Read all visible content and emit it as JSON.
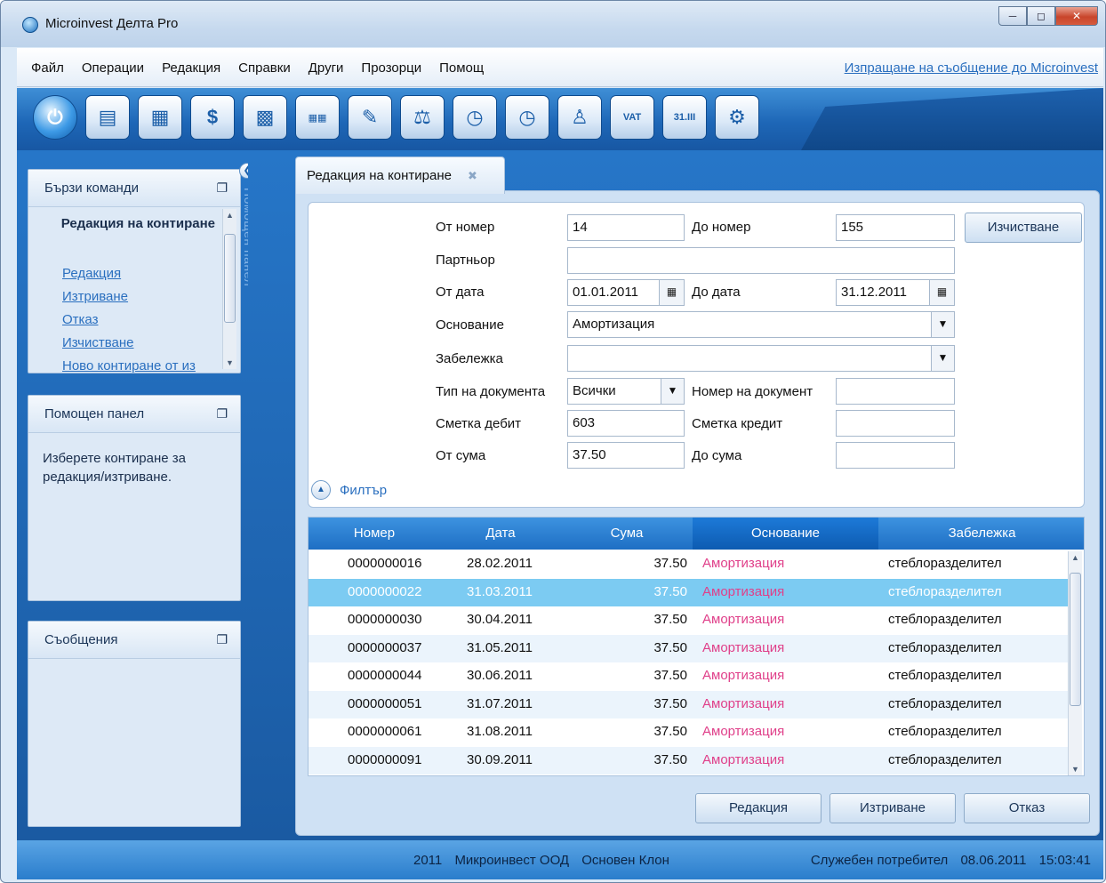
{
  "window": {
    "title": "Microinvest Делта Pro"
  },
  "menu": {
    "items": [
      "Файл",
      "Операции",
      "Редакция",
      "Справки",
      "Други",
      "Прозорци",
      "Помощ"
    ],
    "message_link": "Изпращане на съобщение до Microinvest"
  },
  "toolbar": {
    "buttons": [
      "power-icon",
      "documents-icon",
      "journal-icon",
      "cash-icon",
      "reports-icon",
      "accounts-table-icon",
      "edit-entry-icon",
      "balance-icon",
      "globe-clock-icon",
      "clock-icon",
      "person-icon",
      "vat-icon",
      "calendar-icon",
      "settings-gear-icon"
    ],
    "vat_text": "VAT",
    "cal_text": "31.III"
  },
  "left": {
    "quick_commands": {
      "title": "Бързи команди",
      "heading": "Редакция на контиране",
      "links": [
        "Редакция",
        "Изтриване",
        "Отказ",
        "Изчистване",
        "Ново контиране от из"
      ]
    },
    "help_panel": {
      "title": "Помощен панел",
      "text": "Изберете контиране за редакция/изтриване."
    },
    "messages": {
      "title": "Съобщения"
    },
    "side_label": "Помощен панел"
  },
  "tab": {
    "label": "Редакция на контиране"
  },
  "filter": {
    "from_number_label": "От номер",
    "from_number": "14",
    "to_number_label": "До номер",
    "to_number": "155",
    "clear_button": "Изчистване",
    "partner_label": "Партньор",
    "partner": "",
    "from_date_label": "От дата",
    "from_date": "01.01.2011",
    "to_date_label": "До дата",
    "to_date": "31.12.2011",
    "reason_label": "Основание",
    "reason": "Амортизация",
    "note_label": "Забележка",
    "note": "",
    "doc_type_label": "Тип на документа",
    "doc_type": "Всички",
    "doc_number_label": "Номер на документ",
    "doc_number": "",
    "debit_label": "Сметка дебит",
    "debit": "603",
    "credit_label": "Сметка кредит",
    "credit": "",
    "from_sum_label": "От сума",
    "from_sum": "37.50",
    "to_sum_label": "До сума",
    "to_sum": "",
    "toggle_label": "Филтър"
  },
  "grid": {
    "columns": [
      "Номер",
      "Дата",
      "Сума",
      "Основание",
      "Забележка"
    ],
    "rows": [
      {
        "number": "0000000016",
        "date": "28.02.2011",
        "sum": "37.50",
        "reason": "Амортизация",
        "note": "стеблоразделител"
      },
      {
        "number": "0000000022",
        "date": "31.03.2011",
        "sum": "37.50",
        "reason": "Амортизация",
        "note": "стеблоразделител"
      },
      {
        "number": "0000000030",
        "date": "30.04.2011",
        "sum": "37.50",
        "reason": "Амортизация",
        "note": "стеблоразделител"
      },
      {
        "number": "0000000037",
        "date": "31.05.2011",
        "sum": "37.50",
        "reason": "Амортизация",
        "note": "стеблоразделител"
      },
      {
        "number": "0000000044",
        "date": "30.06.2011",
        "sum": "37.50",
        "reason": "Амортизация",
        "note": "стеблоразделител"
      },
      {
        "number": "0000000051",
        "date": "31.07.2011",
        "sum": "37.50",
        "reason": "Амортизация",
        "note": "стеблоразделител"
      },
      {
        "number": "0000000061",
        "date": "31.08.2011",
        "sum": "37.50",
        "reason": "Амортизация",
        "note": "стеблоразделител"
      },
      {
        "number": "0000000091",
        "date": "30.09.2011",
        "sum": "37.50",
        "reason": "Амортизация",
        "note": "стеблоразделител"
      }
    ]
  },
  "actions": {
    "edit": "Редакция",
    "delete": "Изтриване",
    "cancel": "Отказ"
  },
  "status": {
    "year": "2011",
    "company": "Микроинвест ООД",
    "branch": "Основен Клон",
    "user": "Служебен потребител",
    "date": "08.06.2011",
    "time": "15:03:41"
  },
  "colors": {
    "accent": "#1e6fc4",
    "selected_row": "#7ccbf2",
    "reason_text": "#e0408a",
    "link": "#2a6fbf"
  }
}
